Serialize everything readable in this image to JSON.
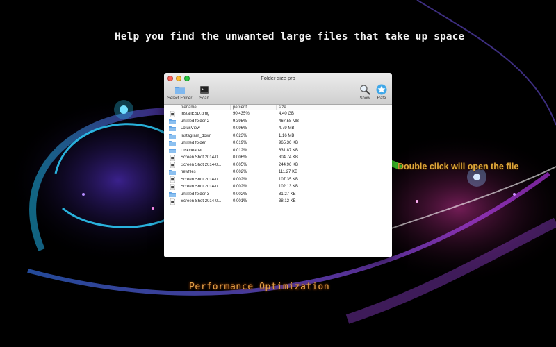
{
  "headline": "Help you find the unwanted large files that take up space",
  "callout": "Double click  will open the file",
  "footer_caption": "Performance Optimization",
  "window": {
    "title": "Folder size pro",
    "toolbar": {
      "select_folder": "Select Folder",
      "scan": "Scan",
      "show": "Show",
      "rate": "Rate"
    },
    "columns": {
      "filename": "filename",
      "percent": "percent",
      "size": "size"
    },
    "rows": [
      {
        "icon": "file-icon",
        "name": "InstallESD.dmg",
        "percent": "90.435%",
        "size": "4.40 GB"
      },
      {
        "icon": "folder-icon",
        "name": "untitled folder 2",
        "percent": "9.395%",
        "size": "467.58 MB"
      },
      {
        "icon": "folder-icon",
        "name": "LotusView",
        "percent": "0.096%",
        "size": "4.79 MB"
      },
      {
        "icon": "folder-icon",
        "name": "Instagram_down",
        "percent": "0.023%",
        "size": "1.16 MB"
      },
      {
        "icon": "folder-icon",
        "name": "untitled folder",
        "percent": "0.019%",
        "size": "965.36 KB"
      },
      {
        "icon": "folder-icon",
        "name": "Diskcleaner",
        "percent": "0.012%",
        "size": "631.87 KB"
      },
      {
        "icon": "file-icon",
        "name": "Screen Shot 2014-0...",
        "percent": "0.006%",
        "size": "304.74 KB"
      },
      {
        "icon": "file-icon",
        "name": "Screen Shot 2014-0...",
        "percent": "0.005%",
        "size": "244.96 KB"
      },
      {
        "icon": "folder-icon",
        "name": "newfiles",
        "percent": "0.002%",
        "size": "111.27 KB"
      },
      {
        "icon": "file-icon",
        "name": "Screen Shot 2014-0...",
        "percent": "0.002%",
        "size": "107.35 KB"
      },
      {
        "icon": "file-icon",
        "name": "Screen Shot 2014-0...",
        "percent": "0.002%",
        "size": "102.13 KB"
      },
      {
        "icon": "folder-icon",
        "name": "untitled folder 3",
        "percent": "0.002%",
        "size": "81.27 KB"
      },
      {
        "icon": "file-icon",
        "name": "Screen Shot 2014-0...",
        "percent": "0.001%",
        "size": "38.12 KB"
      }
    ]
  },
  "colors": {
    "callout": "#e0a83a",
    "arrow": "#3fce2a",
    "folder": "#6aa8e0"
  }
}
